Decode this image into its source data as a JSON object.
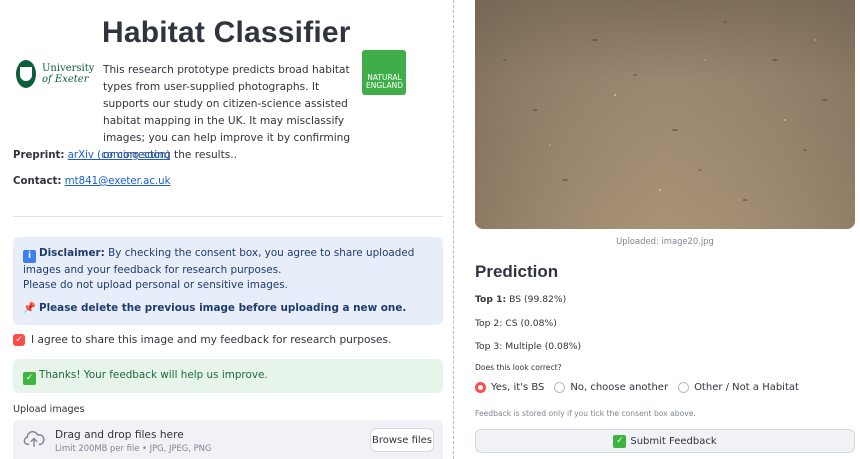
{
  "header": {
    "title": "Habitat Classifier",
    "intro": "This research prototype predicts broad habitat types from user-supplied photographs. It supports our study on citizen-science assisted habitat mapping in the UK. It may misclassify images; you can help improve it by confirming or correcting the results..",
    "uni_logo_line1": "University",
    "uni_logo_line2": "of Exeter",
    "ne_logo_line1": "NATURAL",
    "ne_logo_line2": "ENGLAND"
  },
  "links": {
    "preprint_label": "Preprint:",
    "preprint_text": "arXiv (coming soon)",
    "contact_label": "Contact:",
    "contact_text": "mt841@exeter.ac.uk"
  },
  "disclaimer": {
    "icon": "information-icon",
    "bold": "Disclaimer:",
    "text": " By checking the consent box, you agree to share uploaded images and your feedback for research purposes.",
    "line2": "Please do not upload personal or sensitive images.",
    "pin_icon": "pushpin-icon",
    "pin_text": "Please delete the previous image before uploading a new one."
  },
  "consent": {
    "checked": true,
    "label": "I agree to share this image and my feedback for research purposes."
  },
  "success": {
    "text": "Thanks! Your feedback will help us improve."
  },
  "upload": {
    "label": "Upload images",
    "drop_title": "Drag and drop files here",
    "drop_sub": "Limit 200MB per file • JPG, JPEG, PNG",
    "browse": "Browse files"
  },
  "image": {
    "caption": "Uploaded: image20.jpg"
  },
  "prediction": {
    "title": "Prediction",
    "top1_label": "Top 1:",
    "top1_value": " BS (99.82%)",
    "top2": "Top 2: CS (0.08%)",
    "top3": "Top 3: Multiple (0.08%)",
    "question": "Does this look correct?",
    "options": [
      "Yes, it's BS",
      "No, choose another",
      "Other / Not a Habitat"
    ],
    "selected": 0,
    "note": "Feedback is stored only if you tick the consent box above.",
    "submit": "Submit Feedback"
  },
  "colors": {
    "accent": "#ff4b4b",
    "info_bg": "#e8eef9",
    "success_bg": "#e6f4ea",
    "ne_green": "#3fae49",
    "exeter_green": "#0d5e3b"
  }
}
